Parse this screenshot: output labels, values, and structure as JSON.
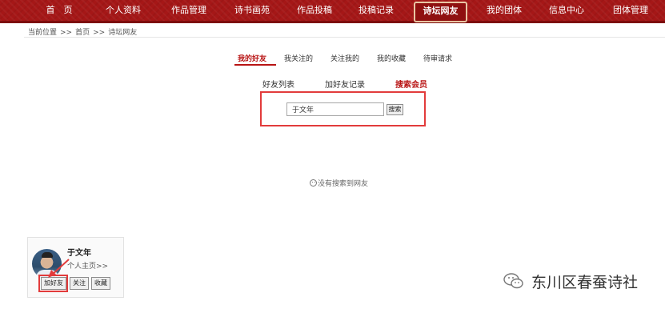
{
  "nav": {
    "items": [
      "首　页",
      "个人资料",
      "作品管理",
      "诗书画苑",
      "作品投稿",
      "投稿记录",
      "诗坛网友",
      "我的团体",
      "信息中心",
      "团体管理"
    ],
    "active": "诗坛网友"
  },
  "breadcrumb": {
    "label": "当前位置",
    "sep": ">>",
    "home": "首页",
    "current": "诗坛网友"
  },
  "tabs_primary": [
    "我的好友",
    "我关注的",
    "关注我的",
    "我的收藏",
    "待审请求"
  ],
  "tabs_secondary": [
    "好友列表",
    "加好友记录",
    "搜索会员"
  ],
  "search": {
    "value": "于文年",
    "button": "搜索"
  },
  "no_result": "没有搜索到网友",
  "user_card": {
    "name": "于文年",
    "homepage": "个人主页>>",
    "buttons": [
      "加好友",
      "关注",
      "收藏"
    ]
  },
  "watermark": "东川区春蚕诗社",
  "colors": {
    "nav_bg": "#a51717",
    "accent": "#b81414",
    "highlight": "#e23b3b"
  }
}
